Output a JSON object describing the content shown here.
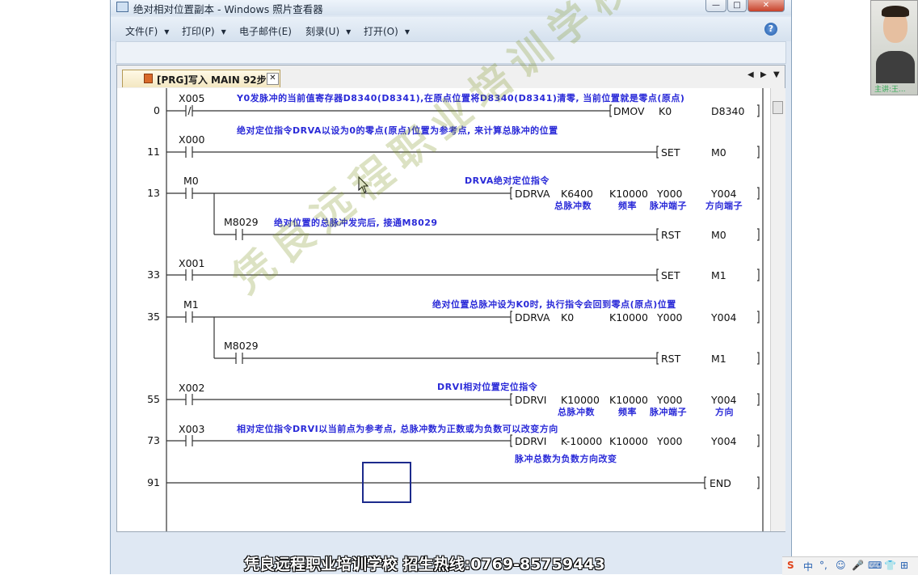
{
  "window": {
    "title": "绝对相对位置副本 - Windows 照片查看器",
    "controls": [
      "—",
      "□",
      "✕"
    ]
  },
  "menu": [
    {
      "label": "文件(F)",
      "has_arrow": true
    },
    {
      "label": "打印(P)",
      "has_arrow": true
    },
    {
      "label": "电子邮件(E)",
      "has_arrow": false
    },
    {
      "label": "刻录(U)",
      "has_arrow": true
    },
    {
      "label": "打开(O)",
      "has_arrow": true
    }
  ],
  "help_icon": "?",
  "editor": {
    "tab_label": "[PRG]写入 MAIN 92步",
    "tab_close": "✕",
    "nav": [
      "◀",
      "▶",
      "▼"
    ]
  },
  "ladder": {
    "steps": [
      "0",
      "11",
      "13",
      "33",
      "35",
      "55",
      "73",
      "91"
    ],
    "contacts": {
      "x005": "X005",
      "x000": "X000",
      "m0": "M0",
      "m8029_a": "M8029",
      "x001": "X001",
      "m1": "M1",
      "m8029_b": "M8029",
      "x002": "X002",
      "x003": "X003"
    },
    "instructions": {
      "r0": [
        "DMOV",
        "K0",
        "D8340"
      ],
      "r11": [
        "SET",
        "M0"
      ],
      "r13": [
        "DDRVA",
        "K6400",
        "K10000",
        "Y000",
        "Y004"
      ],
      "r13b": [
        "RST",
        "M0"
      ],
      "r33": [
        "SET",
        "M1"
      ],
      "r35": [
        "DDRVA",
        "K0",
        "K10000",
        "Y000",
        "Y004"
      ],
      "r35b": [
        "RST",
        "M1"
      ],
      "r55": [
        "DDRVI",
        "K10000",
        "K10000",
        "Y000",
        "Y004"
      ],
      "r73": [
        "DDRVI",
        "K-10000",
        "K10000",
        "Y000",
        "Y004"
      ],
      "r91": [
        "END"
      ]
    },
    "comments": {
      "c0": "Y0发脉冲的当前值寄存器D8340(D8341),在原点位置将D8340(D8341)清零, 当前位置就是零点(原点)",
      "c11": "绝对定位指令DRVA以设为0的零点(原点)位置为参考点, 来计算总脉冲的位置",
      "c13": "DRVA绝对定位指令",
      "c13s": [
        "总脉冲数",
        "频率",
        "脉冲端子",
        "方向端子"
      ],
      "c13b": "绝对位置的总脉冲发完后, 接通M8029",
      "c35": "绝对位置总脉冲设为K0时, 执行指令会回到零点(原点)位置",
      "c55": "DRVI相对位置定位指令",
      "c55s": [
        "总脉冲数",
        "频率",
        "脉冲端子",
        "方向"
      ],
      "c73": "相对定位指令DRVI以当前点为参考点, 总脉冲数为正数或为负数可以改变方向",
      "c73b": "脉冲总数为负数方向改变"
    }
  },
  "watermark": "凭良远程职业培训学校",
  "caption": "凭良远程职业培训学校 招生热线:0769-85759443",
  "webcam_label": "主讲:王...",
  "tray": [
    "S",
    "中",
    "°,",
    "☺",
    "🎤",
    "⌨",
    "👕",
    "⊞"
  ],
  "colors": {
    "comment": "#2a2ad8",
    "ladder_line": "#333333",
    "cursor_box": "#1c2a8c",
    "watermark": "#829628"
  }
}
